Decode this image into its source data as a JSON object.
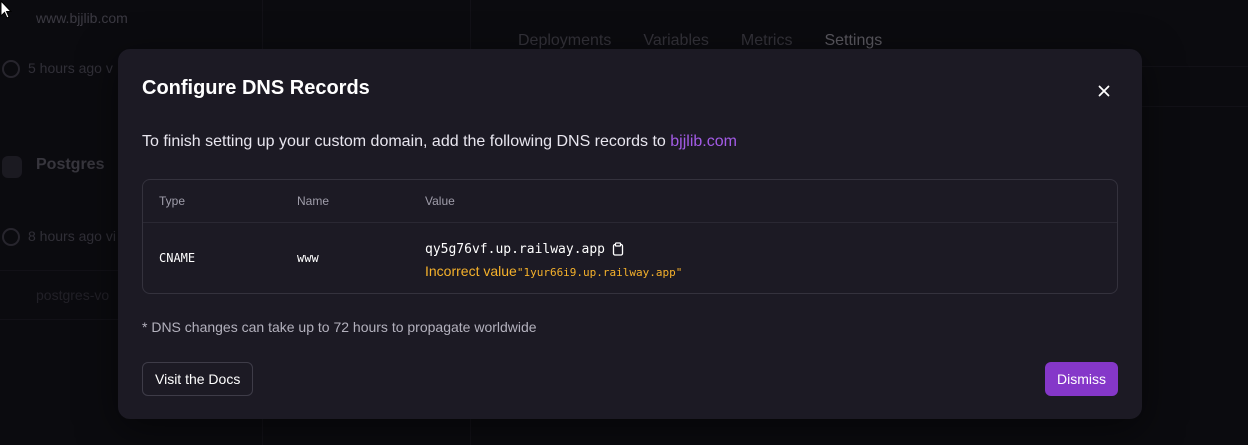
{
  "background": {
    "service_url": "www.bjjlib.com",
    "service_time": "5 hours ago v",
    "postgres_label": "Postgres",
    "postgres_time": "8 hours ago vi",
    "volume_label": "postgres-vo",
    "tabs": [
      "Deployments",
      "Variables",
      "Metrics",
      "Settings"
    ],
    "active_tab": "Settings"
  },
  "modal": {
    "title": "Configure DNS Records",
    "intro_text": "To finish setting up your custom domain, add the following DNS records to ",
    "domain_link": "bjjlib.com",
    "table": {
      "headers": {
        "type": "Type",
        "name": "Name",
        "value": "Value"
      },
      "row": {
        "type": "CNAME",
        "name": "www",
        "value": "qy5g76vf.up.railway.app",
        "warning_label": "Incorrect value ",
        "warning_value": "\"1yur66i9.up.railway.app\""
      }
    },
    "note": "* DNS changes can take up to 72 hours to propagate worldwide",
    "docs_button": "Visit the Docs",
    "dismiss_button": "Dismiss"
  },
  "icons": {
    "close": "close-icon",
    "copy": "copy-icon",
    "check": "check-circle-icon",
    "cursor": "mouse-cursor-icon"
  },
  "colors": {
    "accent": "#8537c9",
    "link": "#a35be6",
    "warning": "#f5b12b",
    "modal_bg": "#1c1a24"
  }
}
